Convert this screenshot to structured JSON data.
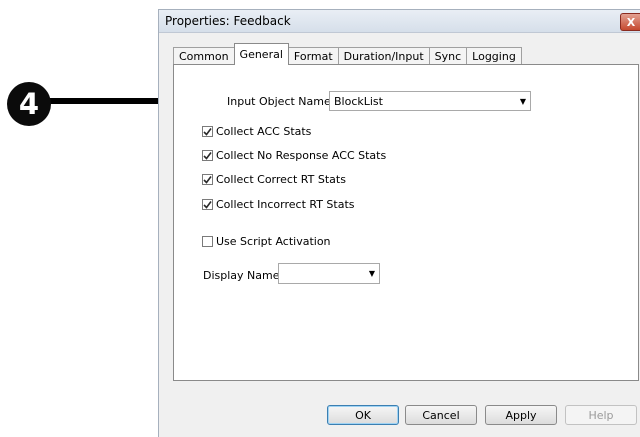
{
  "annotation": {
    "step_number": "4"
  },
  "window": {
    "title": "Properties: Feedback",
    "close_glyph": "X"
  },
  "tabs": [
    {
      "label": "Common",
      "active": false
    },
    {
      "label": "General",
      "active": true
    },
    {
      "label": "Format",
      "active": false
    },
    {
      "label": "Duration/Input",
      "active": false
    },
    {
      "label": "Sync",
      "active": false
    },
    {
      "label": "Logging",
      "active": false
    }
  ],
  "general": {
    "input_object_label": "Input Object Name:",
    "input_object_value": "BlockList",
    "checks": [
      {
        "label": "Collect ACC Stats",
        "checked": true
      },
      {
        "label": "Collect No Response ACC Stats",
        "checked": true
      },
      {
        "label": "Collect Correct RT Stats",
        "checked": true
      },
      {
        "label": "Collect Incorrect RT Stats",
        "checked": true
      }
    ],
    "script_activation": {
      "label": "Use Script Activation",
      "checked": false
    },
    "display_name_label": "Display Name:",
    "display_name_value": ""
  },
  "buttons": {
    "ok": "OK",
    "cancel": "Cancel",
    "apply": "Apply",
    "help": "Help"
  }
}
